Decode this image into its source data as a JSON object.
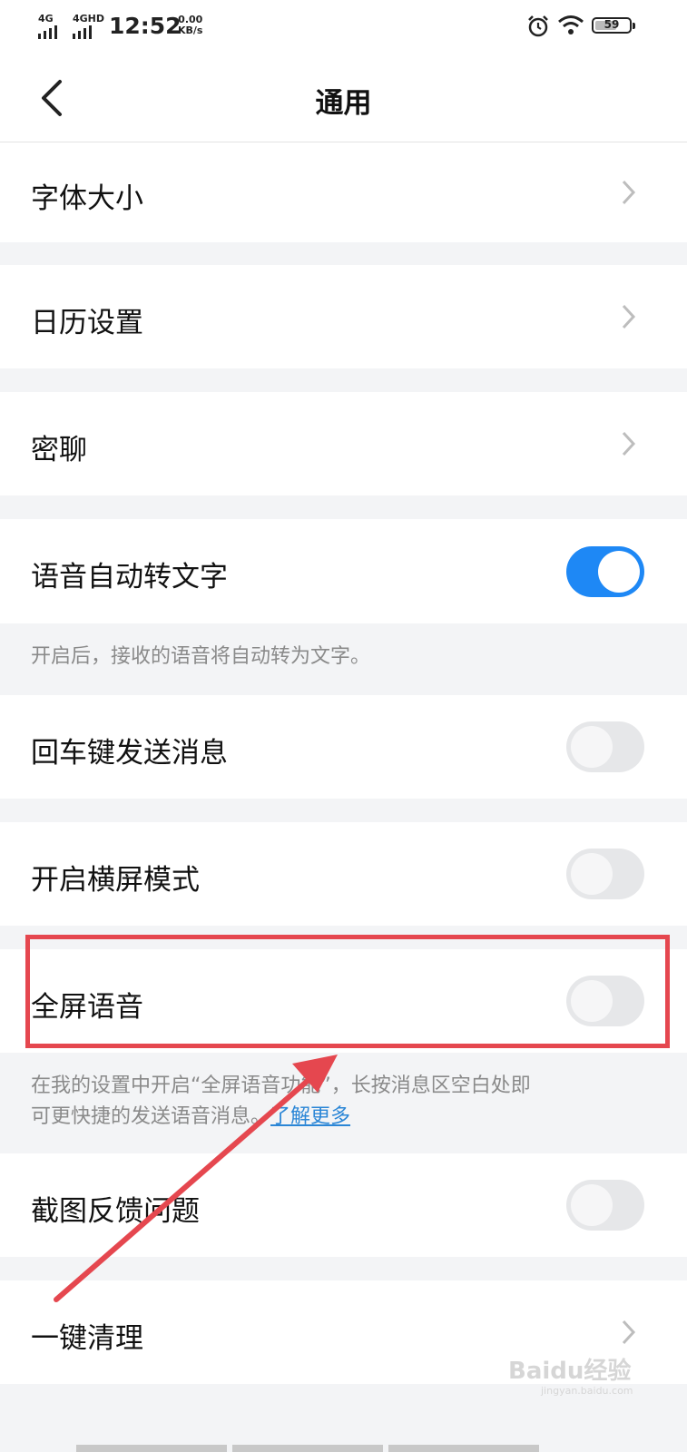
{
  "status_bar": {
    "network1": "4G",
    "network2": "4GHD",
    "time": "12:52",
    "speed_value": "0.00",
    "speed_unit": "KB/s",
    "battery": "59",
    "icons": [
      "alarm-icon",
      "wifi-icon",
      "battery-icon"
    ]
  },
  "nav": {
    "title": "通用",
    "back_icon": "chevron-left-icon"
  },
  "settings": {
    "font_size": "字体大小",
    "calendar": "日历设置",
    "secret_chat": "密聊",
    "voice_to_text": "语音自动转文字",
    "voice_to_text_on": true,
    "voice_to_text_hint": "开启后，接收的语音将自动转为文字。",
    "enter_send": "回车键发送消息",
    "enter_send_on": false,
    "landscape": "开启横屏模式",
    "landscape_on": false,
    "fullscreen_voice": "全屏语音",
    "fullscreen_voice_on": false,
    "fullscreen_hint_line1": "在我的设置中开启“全屏语音功能”，长按消息区空白处即",
    "fullscreen_hint_line2": "可更快捷的发送语音消息。",
    "learn_more": "了解更多",
    "screenshot_feedback": "截图反馈问题",
    "screenshot_feedback_on": false,
    "one_key_clean": "一键清理"
  },
  "watermark": {
    "brand": "Baidu经验",
    "url": "jingyan.baidu.com"
  },
  "colors": {
    "accent": "#1e88f5",
    "highlight": "#e5474f",
    "link": "#2b86d6"
  }
}
